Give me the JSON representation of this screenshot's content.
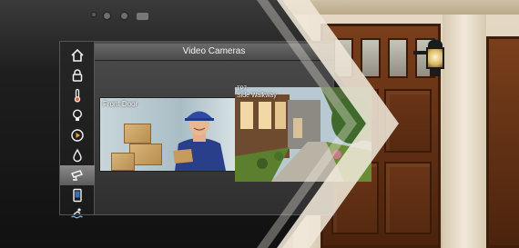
{
  "screen": {
    "title": "Video Cameras",
    "sidebar": [
      {
        "icon": "home-icon"
      },
      {
        "icon": "lock-icon"
      },
      {
        "icon": "thermometer-icon"
      },
      {
        "icon": "lightbulb-icon"
      },
      {
        "icon": "media-play-icon"
      },
      {
        "icon": "water-drop-icon"
      },
      {
        "icon": "security-camera-icon",
        "active": true
      },
      {
        "icon": "tablet-icon"
      },
      {
        "icon": "pool-icon"
      }
    ],
    "cameras": [
      {
        "label": "Front Door"
      },
      {
        "label_top": "TP7",
        "label": "Side Walkway"
      }
    ]
  },
  "colors": {
    "chevron": "#efe7d8",
    "accent_active": "#7a7a7a",
    "door_wood": "#5e2e12"
  }
}
